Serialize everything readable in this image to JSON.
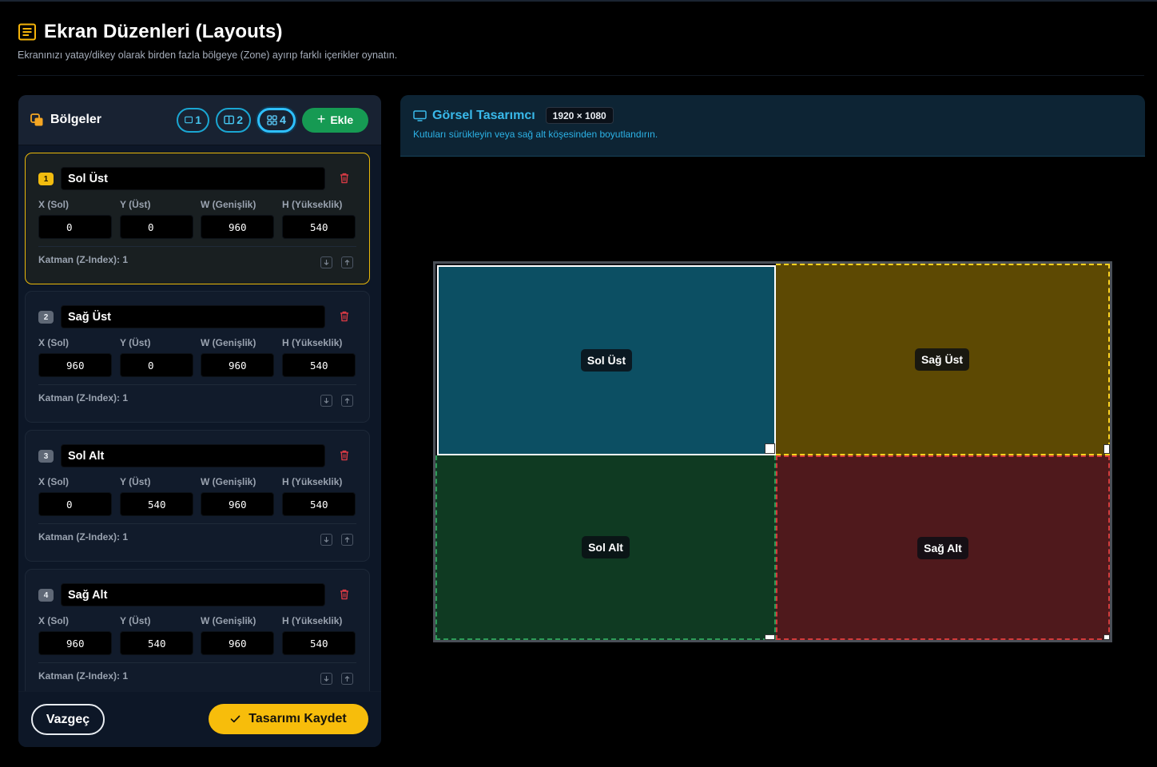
{
  "page": {
    "title": "Ekran Düzenleri (Layouts)",
    "subtitle": "Ekranınızı yatay/dikey olarak birden fazla bölgeye (Zone) ayırıp farklı içerikler oynatın.",
    "title_icon": "layout-list-icon"
  },
  "zones_panel": {
    "title": "Bölgeler",
    "presets": [
      {
        "label": "1",
        "icon": "single-zone-icon",
        "active": false
      },
      {
        "label": "2",
        "icon": "split-zone-icon",
        "active": false
      },
      {
        "label": "4",
        "icon": "grid-zone-icon",
        "active": true
      }
    ],
    "add_label": "Ekle",
    "field_labels": {
      "x": "X (Sol)",
      "y": "Y (Üst)",
      "w": "W (Genişlik)",
      "h": "H (Yükseklik)"
    },
    "zones": [
      {
        "index": "1",
        "name": "Sol Üst",
        "x": "0",
        "y": "0",
        "w": "960",
        "h": "540",
        "zindex_text": "Katman (Z-Index): 1",
        "selected": true
      },
      {
        "index": "2",
        "name": "Sağ Üst",
        "x": "960",
        "y": "0",
        "w": "960",
        "h": "540",
        "zindex_text": "Katman (Z-Index): 1",
        "selected": false
      },
      {
        "index": "3",
        "name": "Sol Alt",
        "x": "0",
        "y": "540",
        "w": "960",
        "h": "540",
        "zindex_text": "Katman (Z-Index): 1",
        "selected": false
      },
      {
        "index": "4",
        "name": "Sağ Alt",
        "x": "960",
        "y": "540",
        "w": "960",
        "h": "540",
        "zindex_text": "Katman (Z-Index): 1",
        "selected": false
      }
    ],
    "cancel_label": "Vazgeç",
    "save_label": "Tasarımı Kaydet"
  },
  "designer": {
    "title": "Görsel Tasarımcı",
    "resolution": "1920 × 1080",
    "hint": "Kutuları sürükleyin veya sağ alt köşesinden boyutlandırın.",
    "canvas_zones": [
      {
        "label": "Sol Üst",
        "color": "#0c4f63",
        "border": "#ffffff"
      },
      {
        "label": "Sağ Üst",
        "color": "#5d4903",
        "border": "#ffd21f"
      },
      {
        "label": "Sol Alt",
        "color": "#0f3a22",
        "border": "#2c9a57"
      },
      {
        "label": "Sağ Alt",
        "color": "#4f191c",
        "border": "#d23a3a"
      }
    ]
  },
  "colors": {
    "accent_yellow": "#f7bd0b",
    "accent_cyan": "#39b9ea",
    "add_green": "#169a53",
    "delete_red": "#e0424a"
  }
}
